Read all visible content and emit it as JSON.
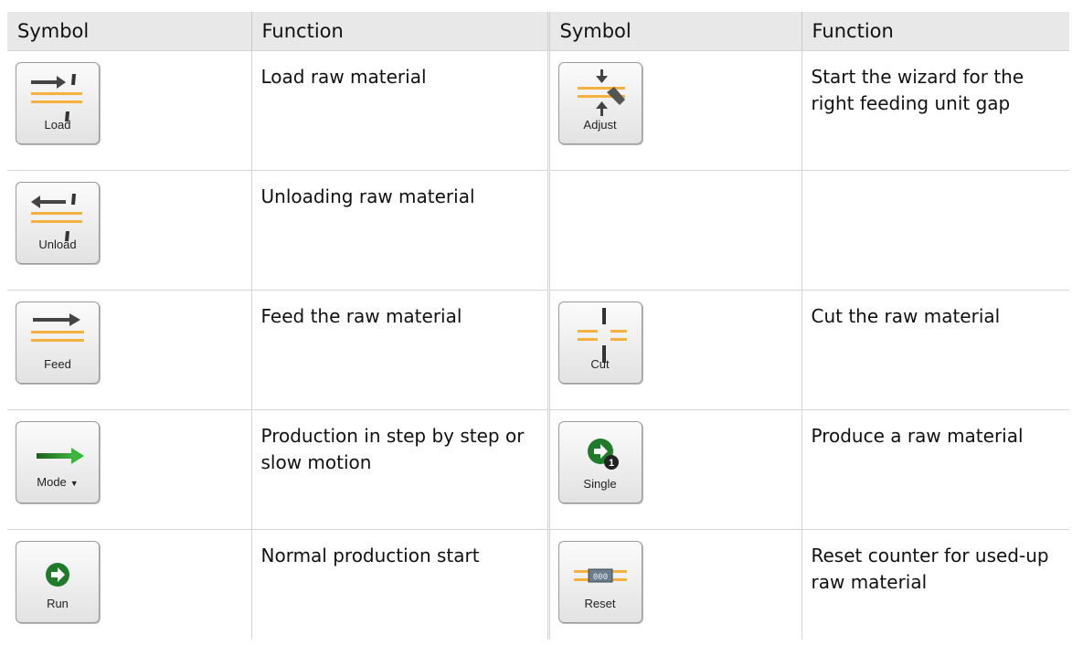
{
  "headers": {
    "symbol_1": "Symbol",
    "function_1": "Function",
    "symbol_2": "Symbol",
    "function_2": "Function"
  },
  "rows": [
    {
      "left": {
        "button": "Load",
        "text": "Load raw material"
      },
      "right": {
        "button": "Adjust",
        "text": "Start the wizard for the right feeding unit gap"
      }
    },
    {
      "left": {
        "button": "Unload",
        "text": "Unloading raw material"
      },
      "right": {
        "button": "",
        "text": ""
      }
    },
    {
      "left": {
        "button": "Feed",
        "text": "Feed the raw material"
      },
      "right": {
        "button": "Cut",
        "text": "Cut the raw material"
      }
    },
    {
      "left": {
        "button": "Mode",
        "text": "Production in step by step or slow motion"
      },
      "right": {
        "button": "Single",
        "text": "Produce a raw material"
      }
    },
    {
      "left": {
        "button": "Run",
        "text": "Normal production start"
      },
      "right": {
        "button": "Reset",
        "text": "Reset counter for used-up raw material"
      }
    }
  ],
  "icons": {
    "load": "load-icon",
    "adjust": "adjust-icon",
    "unload": "unload-icon",
    "feed": "feed-icon",
    "cut": "cut-icon",
    "mode": "mode-icon",
    "single": "single-icon",
    "run": "run-icon",
    "reset": "reset-icon"
  },
  "reset_counter_digits": "000",
  "single_badge": "1",
  "colors": {
    "material": "#f5b13d",
    "arrow_dark": "#444444",
    "green": "#2e9a2e",
    "header_bg": "#e8e8e8"
  }
}
